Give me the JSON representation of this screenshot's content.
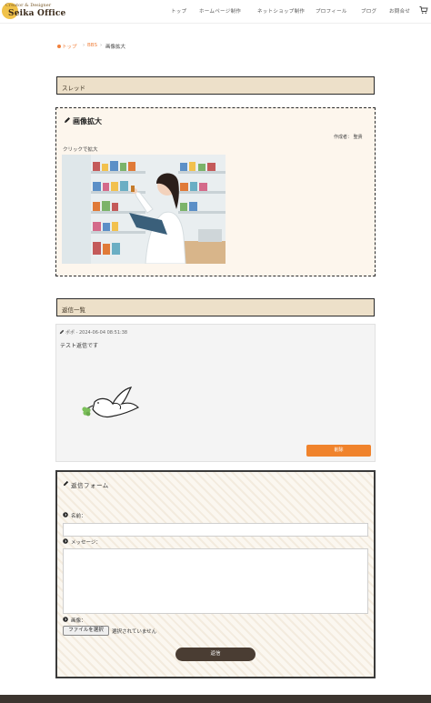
{
  "header": {
    "logo_small": "Creator & Designer",
    "logo_main": "Seika Office",
    "nav": [
      "トップ",
      "ホームページ制作",
      "ネットショップ制作",
      "プロフィール",
      "ブログ",
      "お問合せ"
    ]
  },
  "breadcrumb": {
    "home": "トップ",
    "bbs": "BBS",
    "current": "画像拡大"
  },
  "thread_section": {
    "heading": "スレッド",
    "title": "画像拡大",
    "author": "作成者： 聖貴",
    "zoom_hint": "クリックで拡大"
  },
  "replies_section": {
    "heading": "返信一覧",
    "reply": {
      "meta": "ポポ - 2024-06-04 08:51:38",
      "text": "テスト返信です",
      "delete_label": "削除"
    }
  },
  "form": {
    "title": "返信フォーム",
    "name_label": "名前：",
    "message_label": "メッセージ：",
    "image_label": "画像：",
    "file_button": "ファイルを選択",
    "file_note": "選択されていません",
    "submit_label": "返信"
  },
  "colors": {
    "accent": "#f0832c",
    "heading_bg": "#ede0c9",
    "thread_bg": "#fdf6ed",
    "submit_bg": "#4a3d33"
  }
}
